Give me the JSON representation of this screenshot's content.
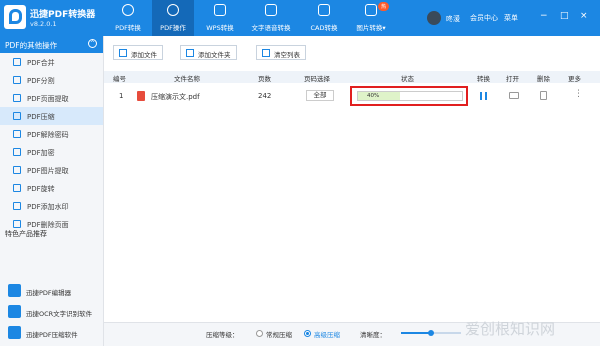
{
  "app": {
    "name": "迅捷PDF转换器",
    "version": "v8.2.0.1"
  },
  "nav_tabs": [
    {
      "label": "PDF转换",
      "icon": "refresh-icon"
    },
    {
      "label": "PDF操作",
      "icon": "gear-icon"
    },
    {
      "label": "WPS转换",
      "icon": "wps-icon"
    },
    {
      "label": "文字语音转换",
      "icon": "audio-icon"
    },
    {
      "label": "CAD转换",
      "icon": "cad-icon"
    },
    {
      "label": "图片转换▾",
      "icon": "image-icon"
    }
  ],
  "hot_badge": "热",
  "user": {
    "name": "咚湲",
    "vip": "会员中心",
    "menu": "菜单"
  },
  "window_buttons": {
    "min": "−",
    "max": "□",
    "close": "×"
  },
  "sidebar": {
    "header": "PDF的其他操作",
    "collapse": "^",
    "items": [
      "PDF合并",
      "PDF分割",
      "PDF页面提取",
      "PDF压缩",
      "PDF解除密码",
      "PDF加密",
      "PDF图片提取",
      "PDF旋转",
      "PDF添加水印",
      "PDF删除页面"
    ],
    "active_index": 3,
    "featured_title": "特色产品推荐",
    "products": [
      "迅捷PDF编辑器",
      "迅捷OCR文字识别软件",
      "迅捷PDF压缩软件"
    ]
  },
  "toolbar": {
    "add_file": "添加文件",
    "add_folder": "添加文件夹",
    "clear_list": "清空列表"
  },
  "table": {
    "headers": [
      "编号",
      "文件名称",
      "页数",
      "页码选择",
      "状态",
      "转换",
      "打开",
      "删除",
      "更多"
    ],
    "rows": [
      {
        "no": "1",
        "name": "压缩演示文.pdf",
        "pages": "242",
        "pagesel": "全部",
        "progress_label": "40%",
        "progress": 0.4,
        "more": "⋮"
      }
    ]
  },
  "bottom": {
    "level_label": "压缩等级：",
    "normal": "常规压缩",
    "high": "高级压缩",
    "clarity": "清晰度：",
    "clarity_value": 0.5
  },
  "watermark": "爱创根知识网",
  "colors": {
    "brand": "#1c87e3",
    "highlight": "#e11f1f",
    "progress": "#dff3c9"
  }
}
